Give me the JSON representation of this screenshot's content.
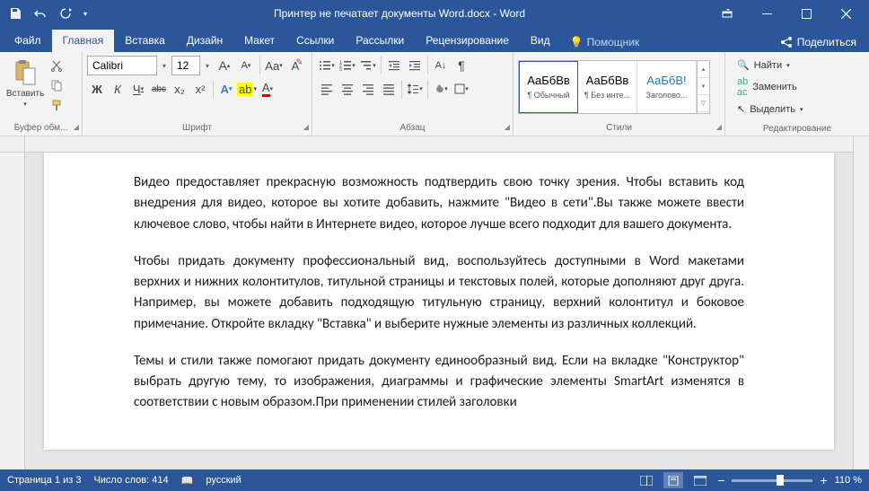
{
  "title": "Принтер не печатает документы Word.docx  -  Word",
  "tabs": [
    "Файл",
    "Главная",
    "Вставка",
    "Дизайн",
    "Макет",
    "Ссылки",
    "Рассылки",
    "Рецензирование",
    "Вид"
  ],
  "active_tab": 1,
  "helper": "Помощник",
  "share": "Поделиться",
  "clipboard": {
    "paste": "Вставить",
    "group": "Буфер обм..."
  },
  "font": {
    "name": "Calibri",
    "size": "12",
    "group": "Шрифт",
    "bold": "Ж",
    "italic": "К",
    "underline": "Ч",
    "strike": "abc",
    "sub": "x₂",
    "sup": "x²"
  },
  "paragraph": {
    "group": "Абзац"
  },
  "styles": {
    "group": "Стили",
    "items": [
      {
        "sample": "АаБбВв",
        "label": "¶ Обычный"
      },
      {
        "sample": "АаБбВв",
        "label": "¶ Без инте..."
      },
      {
        "sample": "АаБбВ!",
        "label": "Заголово..."
      }
    ]
  },
  "editing": {
    "group": "Редактирование",
    "find": "Найти",
    "replace": "Заменить",
    "select": "Выделить"
  },
  "document": {
    "p1": "Видео предоставляет прекрасную возможность подтвердить свою точку зрения. Чтобы вставить код внедрения для видео, которое вы хотите добавить, нажмите \"Видео в сети\".Вы также можете ввести ключевое слово, чтобы найти в Интернете видео, которое лучше всего подходит для вашего документа.",
    "p2": "Чтобы придать документу профессиональный вид, воспользуйтесь доступными в Word макетами верхних и нижних колонтитулов, титульной страницы и текстовых полей, которые дополняют друг друга. Например, вы можете добавить подходящую титульную страницу, верхний колонтитул и боковое примечание. Откройте вкладку \"Вставка\" и выберите нужные элементы из различных коллекций.",
    "p3": "Темы и стили также помогают придать документу единообразный вид. Если на вкладке \"Конструктор\" выбрать другую тему, то изображения, диаграммы и графические элементы SmartArt изменятся в соответствии с новым образом.При применении стилей заголовки"
  },
  "status": {
    "page": "Страница 1 из 3",
    "words": "Число слов: 414",
    "lang": "русский",
    "zoom": "110 %"
  }
}
